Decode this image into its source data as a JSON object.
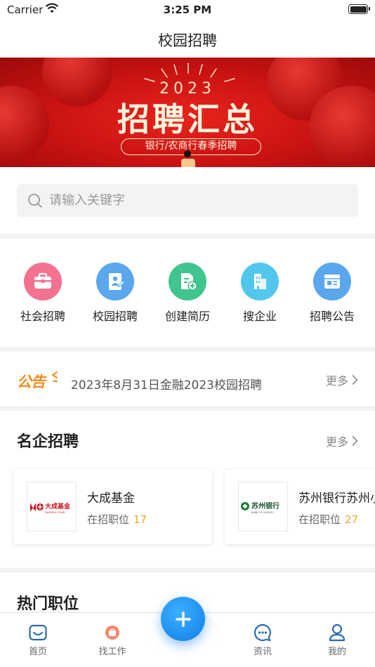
{
  "status_bar": {
    "carrier": "Carrier",
    "time": "3:25 PM"
  },
  "header": {
    "title": "校园招聘"
  },
  "banner": {
    "year": "2023",
    "headline": "招聘汇总",
    "subtitle": "银行/农商行春季招聘"
  },
  "search": {
    "placeholder": "请输入关键字",
    "value": ""
  },
  "quick_links": [
    {
      "label": "社会招聘",
      "icon": "briefcase-icon",
      "color": "#f2728f"
    },
    {
      "label": "校园招聘",
      "icon": "student-id-icon",
      "color": "#5aa7ee"
    },
    {
      "label": "创建简历",
      "icon": "resume-add-icon",
      "color": "#3fc58d"
    },
    {
      "label": "搜企业",
      "icon": "building-icon",
      "color": "#52c7ee"
    },
    {
      "label": "招聘公告",
      "icon": "notice-board-icon",
      "color": "#5aa7ee"
    }
  ],
  "notice": {
    "logo": "公告",
    "text": "2023年8月31日金融2023校园招聘",
    "more": "更多"
  },
  "companies": {
    "title": "名企招聘",
    "more": "更多",
    "items": [
      {
        "name": "大成基金",
        "positions_label": "在招职位",
        "count": "17",
        "logo_text": "大成基金",
        "logo_sub": "DACHENG FUND"
      },
      {
        "name": "苏州银行苏州小",
        "positions_label": "在招职位",
        "count": "27",
        "logo_text": "苏州银行",
        "logo_sub": "BANK OF SUZHOU"
      }
    ]
  },
  "hot_positions": {
    "title": "热门职位"
  },
  "tab_bar": {
    "items": [
      {
        "label": "首页",
        "icon": "home-inbox-icon"
      },
      {
        "label": "找工作",
        "icon": "find-job-icon"
      },
      {
        "label": "资讯",
        "icon": "chat-bubble-icon"
      },
      {
        "label": "我的",
        "icon": "profile-icon"
      }
    ],
    "fab_icon": "plus-icon"
  },
  "colors": {
    "accent": "#f0a32b",
    "fab": "#1f8ef1",
    "banner_red": "#d0161a"
  }
}
